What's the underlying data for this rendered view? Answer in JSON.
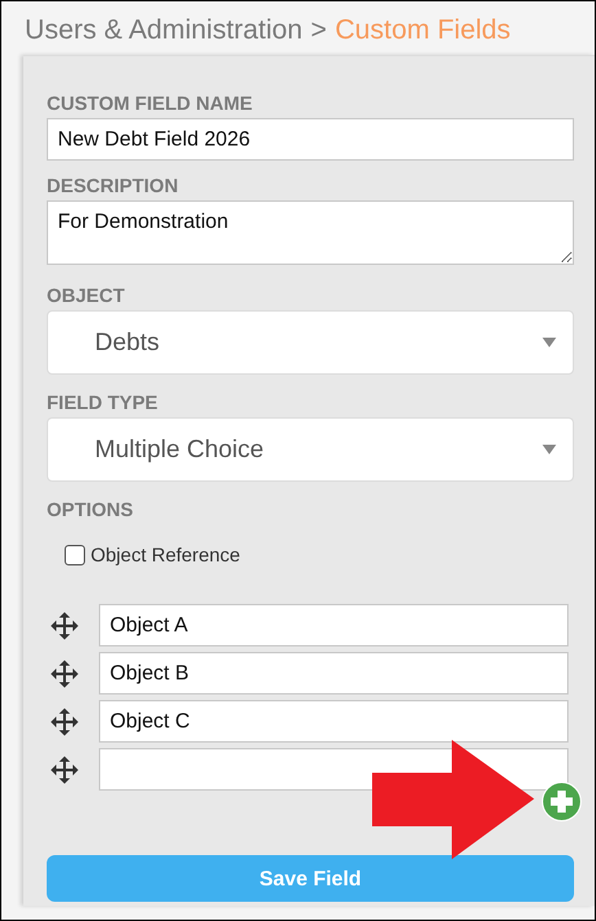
{
  "breadcrumb": {
    "parent": "Users & Administration",
    "separator": ">",
    "current": "Custom Fields"
  },
  "name_field": {
    "label": "CUSTOM FIELD NAME",
    "value": "New Debt Field 2026"
  },
  "description_field": {
    "label": "DESCRIPTION",
    "value": "For Demonstration"
  },
  "object_select": {
    "label": "OBJECT",
    "value": "Debts"
  },
  "field_type_select": {
    "label": "FIELD TYPE",
    "value": "Multiple Choice"
  },
  "options": {
    "label": "OPTIONS",
    "checkbox": {
      "label": "Object Reference",
      "checked": false
    },
    "items": [
      {
        "kind": "text",
        "value": "Object A"
      },
      {
        "kind": "text",
        "value": "Object B"
      },
      {
        "kind": "text",
        "value": "Object C"
      },
      {
        "kind": "blank"
      }
    ]
  },
  "save_button": "Save Field"
}
